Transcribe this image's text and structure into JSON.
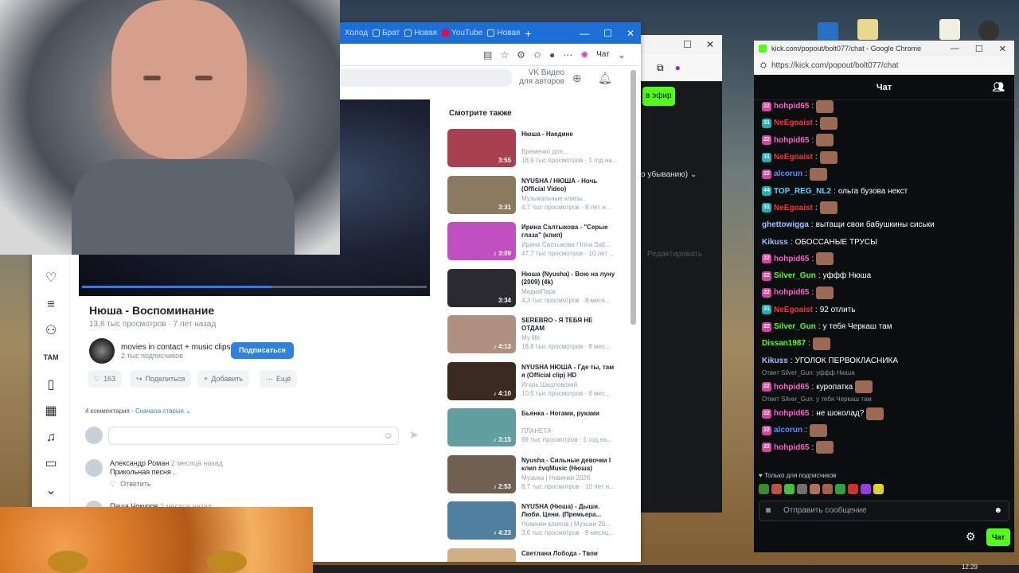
{
  "vk": {
    "tabs": [
      {
        "label": "Холод"
      },
      {
        "label": "Брат"
      },
      {
        "label": "Новая"
      },
      {
        "label": "YouTube"
      },
      {
        "label": "Новая"
      }
    ],
    "addressbar": {
      "chat_label": "Чат"
    },
    "header": {
      "vkvideo_line1": "VK Видео",
      "vkvideo_line2": "для авторов"
    },
    "video": {
      "title": "Нюша - Воспоминание",
      "views": "13,8 тыс просмотров",
      "age": "7 лет назад",
      "progress": 0.55
    },
    "channel": {
      "name": "movies in contact + music clips",
      "subs": "2 тыс подписчиков",
      "subscribe_label": "Подписаться"
    },
    "actions": {
      "like_count": "163",
      "share_label": "Поделиться",
      "add_label": "Добавить",
      "more_label": "Ещё"
    },
    "comments": {
      "count_label": "4 комментария",
      "sort_label": "Сначала старые",
      "comment1": {
        "author": "Александр Роман",
        "time": "2 месяца назад",
        "text": "Прикольная песня .",
        "reply_label": "Ответить"
      },
      "comment2": {
        "author": "Паша Чокуров",
        "time": "2 месяца назад"
      }
    },
    "related_title": "Смотрите также",
    "related": [
      {
        "title": "Нюша - Наедине",
        "author": "Времечко для...",
        "stats": "18,9 тыс просмотров · 1 год на...",
        "duration": "3:55",
        "color": "#a84050"
      },
      {
        "title": "NYUSHA / НЮША - Ночь (Official Video)",
        "author": "Музыкальные клипы.",
        "stats": "4,7 тыс просмотров · 8 лет н...",
        "duration": "3:31",
        "color": "#8a7a60"
      },
      {
        "title": "Ирина Салтыкова - \"Серые глаза\" (клип)",
        "author": "Ирина Салтыкова / Irina Salt...",
        "stats": "47,7 тыс просмотров · 10 лет ...",
        "duration": "♪ 3:09",
        "color": "#c050c0"
      },
      {
        "title": "Нюша (Nyusha) - Вою на луну (2009) (4k)",
        "author": "МедиаПарк",
        "stats": "4,3 тыс просмотров · 8 меся...",
        "duration": "3:34",
        "color": "#2a2a30"
      },
      {
        "title": "SEREBRO - Я ТЕБЯ НЕ ОТДАМ",
        "author": "My life",
        "stats": "18,8 тыс просмотров · 8 мес...",
        "duration": "♪ 4:13",
        "color": "#b09080"
      },
      {
        "title": "NYUSHA НЮША - Где ты, там я (Official clip) HD",
        "author": "Игорь Шидловский",
        "stats": "10,5 тыс просмотров · 6 мес...",
        "duration": "♪ 4:10",
        "color": "#3a2a20"
      },
      {
        "title": "Бьянка - Ногами, руками",
        "author": "ПЛАНЕТА",
        "stats": "88 тыс просмотров · 1 год на...",
        "duration": "♪ 3:15",
        "color": "#60a0a0"
      },
      {
        "title": "Nyusha - Сильные девочки I клип #vqMusic (Нюша)",
        "author": "Музыка | Новинки 2026",
        "stats": "8,7 тыс просмотров · 10 лет н...",
        "duration": "♪ 2:53",
        "color": "#706050"
      },
      {
        "title": "NYUSHA (Нюша) - Дыши. Люби. Цени. (Премьера...",
        "author": "Новинки клипов | Музыки 20...",
        "stats": "3,6 тыс просмотров · 9 месяц...",
        "duration": "♪ 4:23",
        "color": "#5080a0"
      },
      {
        "title": "Светлана Лобода - Твои",
        "author": "",
        "stats": "",
        "duration": "",
        "color": "#d0b080"
      }
    ]
  },
  "mid": {
    "live_label": "в эфир",
    "sort_label": "о убыванию)",
    "edit_label": "Редактировать"
  },
  "kick": {
    "window_title": "kick.com/popout/bolt077/chat - Google Chrome",
    "url": "https://kick.com/popout/bolt077/chat",
    "header": "Чат",
    "messages": [
      {
        "badge": "22",
        "badge_color": "#e040a0",
        "user": "hohpid65",
        "user_color": "#ff5ec8",
        "text": "",
        "emote": true
      },
      {
        "badge": "31",
        "badge_color": "#20b0b0",
        "user": "NeEgoaist",
        "user_color": "#ff3030",
        "text": "",
        "emote": true
      },
      {
        "badge": "22",
        "badge_color": "#e040a0",
        "user": "hohpid65",
        "user_color": "#ff5ec8",
        "text": "",
        "emote": true
      },
      {
        "badge": "31",
        "badge_color": "#20b0b0",
        "user": "NeEgoaist",
        "user_color": "#ff3030",
        "text": "",
        "emote": true
      },
      {
        "badge": "22",
        "badge_color": "#e040a0",
        "user": "alcorun",
        "user_color": "#5a8cff",
        "text": "",
        "emote": true
      },
      {
        "badge": "44",
        "badge_color": "#20b0b0",
        "user": "TOP_REG_NL2",
        "user_color": "#5ad0ff",
        "text": "ольга бузова некст",
        "emote": false
      },
      {
        "badge": "31",
        "badge_color": "#20b0b0",
        "user": "NeEgoaist",
        "user_color": "#ff3030",
        "text": "",
        "emote": true
      },
      {
        "badge": "",
        "badge_color": "",
        "user": "ghettowigga",
        "user_color": "#a0c0ff",
        "text": "вытащи свои бабушкины сиськи",
        "emote": false
      },
      {
        "badge": "",
        "badge_color": "",
        "user": "Kikuss",
        "user_color": "#a0c0ff",
        "text": "ОБОССАНЫЕ ТРУСЫ",
        "emote": false
      },
      {
        "badge": "22",
        "badge_color": "#e040a0",
        "user": "hohpid65",
        "user_color": "#ff5ec8",
        "text": "",
        "emote": true
      },
      {
        "badge": "22",
        "badge_color": "#e040a0",
        "user": "Silver_Gun",
        "user_color": "#53fc18",
        "text": "уффф Нюша",
        "emote": false
      },
      {
        "badge": "22",
        "badge_color": "#e040a0",
        "user": "hohpid65",
        "user_color": "#ff5ec8",
        "text": "",
        "emote": true
      },
      {
        "badge": "31",
        "badge_color": "#20b0b0",
        "user": "NeEgoaist",
        "user_color": "#ff3030",
        "text": "92 отлить",
        "emote": false
      },
      {
        "badge": "22",
        "badge_color": "#e040a0",
        "user": "Silver_Gun",
        "user_color": "#53fc18",
        "text": "у тебя Черкаш там",
        "emote": false
      },
      {
        "badge": "",
        "badge_color": "",
        "user": "Dissan1987",
        "user_color": "#53fc18",
        "text": "",
        "emote": true
      },
      {
        "badge": "",
        "badge_color": "",
        "user": "Kikuss",
        "user_color": "#a0c0ff",
        "text": "УГОЛОК ПЕРВОКЛАСНИКА",
        "emote": false
      },
      {
        "reply": "Ответ Silver_Gun: уффф Нюша"
      },
      {
        "badge": "22",
        "badge_color": "#e040a0",
        "user": "hohpid65",
        "user_color": "#ff5ec8",
        "text": "куропатка",
        "emote": true
      },
      {
        "reply": "Ответ Silver_Gun: у тебя Черкаш там"
      },
      {
        "badge": "22",
        "badge_color": "#e040a0",
        "user": "hohpid65",
        "user_color": "#ff5ec8",
        "text": "не шоколад?",
        "emote": true
      },
      {
        "badge": "22",
        "badge_color": "#e040a0",
        "user": "alcorun",
        "user_color": "#5a8cff",
        "text": "",
        "emote": true
      },
      {
        "badge": "22",
        "badge_color": "#e040a0",
        "user": "hohpid65",
        "user_color": "#ff5ec8",
        "text": "",
        "emote": true
      }
    ],
    "subonly_label": "Только для подписчиков",
    "input_placeholder": "Отправить сообщение",
    "chat_button": "Чат"
  },
  "taskbar": {
    "clock": "12:29"
  }
}
